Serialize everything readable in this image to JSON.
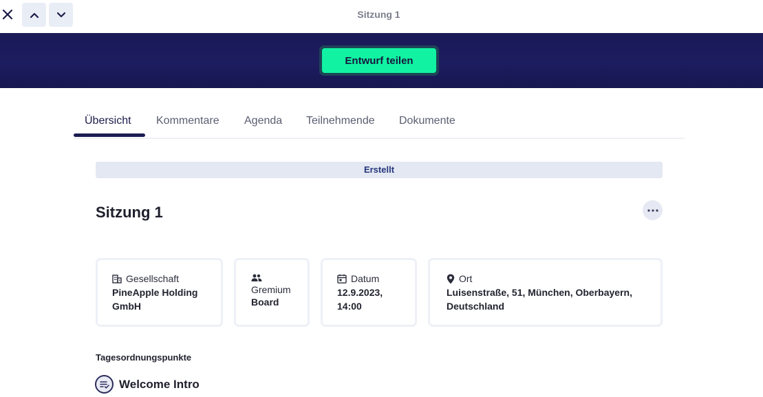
{
  "window": {
    "title": "Sitzung 1"
  },
  "banner": {
    "share_button": "Entwurf teilen",
    "color": "#1c1c60",
    "button_color": "#11f3a3"
  },
  "tabs": [
    {
      "label": "Übersicht",
      "active": true
    },
    {
      "label": "Kommentare",
      "active": false
    },
    {
      "label": "Agenda",
      "active": false
    },
    {
      "label": "Teilnehmende",
      "active": false
    },
    {
      "label": "Dokumente",
      "active": false
    }
  ],
  "status": "Erstellt",
  "meeting": {
    "title": "Sitzung 1"
  },
  "info_cards": {
    "company": {
      "label": "Gesellschaft",
      "value_line1": "PineApple Holding",
      "value_line2": "GmbH",
      "icon": "building-icon"
    },
    "committee": {
      "label": "Gremium",
      "value": "Board",
      "icon": "people-icon"
    },
    "date": {
      "label": "Datum",
      "value_line1": "12.9.2023,",
      "value_line2": "14:00",
      "icon": "calendar-icon"
    },
    "location": {
      "label": "Ort",
      "value_line1": "Luisenstraße, 51, München, Oberbayern,",
      "value_line2": "Deutschland",
      "icon": "location-pin-icon"
    }
  },
  "agenda": {
    "heading": "Tagesordnungspunkte",
    "items": [
      {
        "title": "Welcome Intro",
        "icon": "list-check-icon"
      }
    ]
  }
}
